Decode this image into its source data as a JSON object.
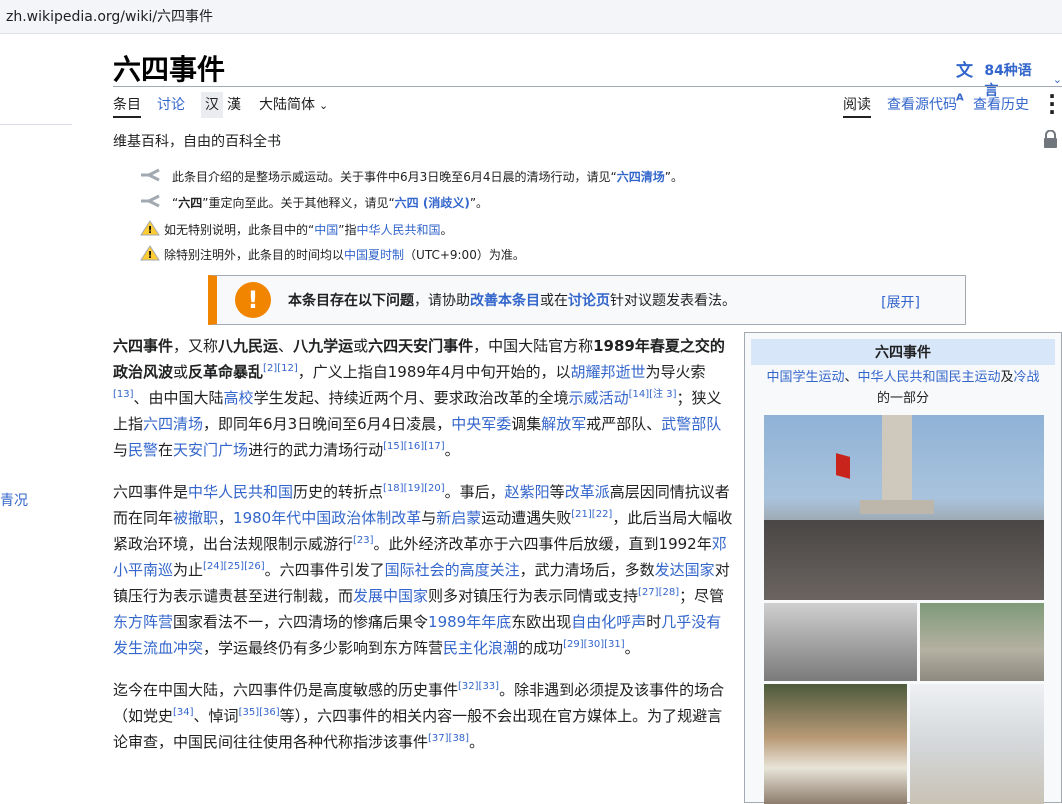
{
  "browser": {
    "url": "zh.wikipedia.org/wiki/六四事件"
  },
  "leftnav": {
    "fragment": "青况"
  },
  "page": {
    "title": "六四事件",
    "languages": "84种语言",
    "tagline": "维基百科，自由的百科全书"
  },
  "tabs": {
    "article": "条目",
    "talk": "讨论",
    "variant_simplified": "汉",
    "variant_traditional": "漢",
    "variant_dropdown": "大陆简体",
    "read": "阅读",
    "view_source": "查看源代码",
    "history": "查看历史"
  },
  "hatnotes": [
    {
      "pre": "此条目介绍的是整场示威运动。关于事件中6月3日晚至6月4日晨的清场行动，请见“",
      "link": "六四清场",
      "post": "”。"
    },
    {
      "pre": "“",
      "bold": "六四",
      "mid": "”重定向至此。关于其他释义，请见“",
      "link": "六四 (消歧义)",
      "post": "”。"
    },
    {
      "pre": "如无特别说明，此条目中的“",
      "link1": "中国",
      "mid": "”指",
      "link2": "中华人民共和国",
      "post": "。"
    },
    {
      "pre": "除特别注明外，此条目的时间均以",
      "link": "中国夏时制",
      "post": "（UTC+9:00）为准。"
    }
  ],
  "message_box": {
    "bold": "本条目存在以下问题",
    "t1": "，请协助",
    "link1": "改善本条目",
    "t2": "或在",
    "link2": "讨论页",
    "t3": "针对议题发表看法。",
    "expand": "[展开]"
  },
  "infobox": {
    "title": "六四事件",
    "link1": "中国学生运动",
    "sep": "、",
    "link2": "中华人民共和国民主运动",
    "and": "及",
    "link3": "冷战",
    "tail": "的一部分"
  },
  "colors": {
    "link": "#3366cc",
    "warning": "#f28500",
    "infobox_header": "#d8e6f9"
  }
}
